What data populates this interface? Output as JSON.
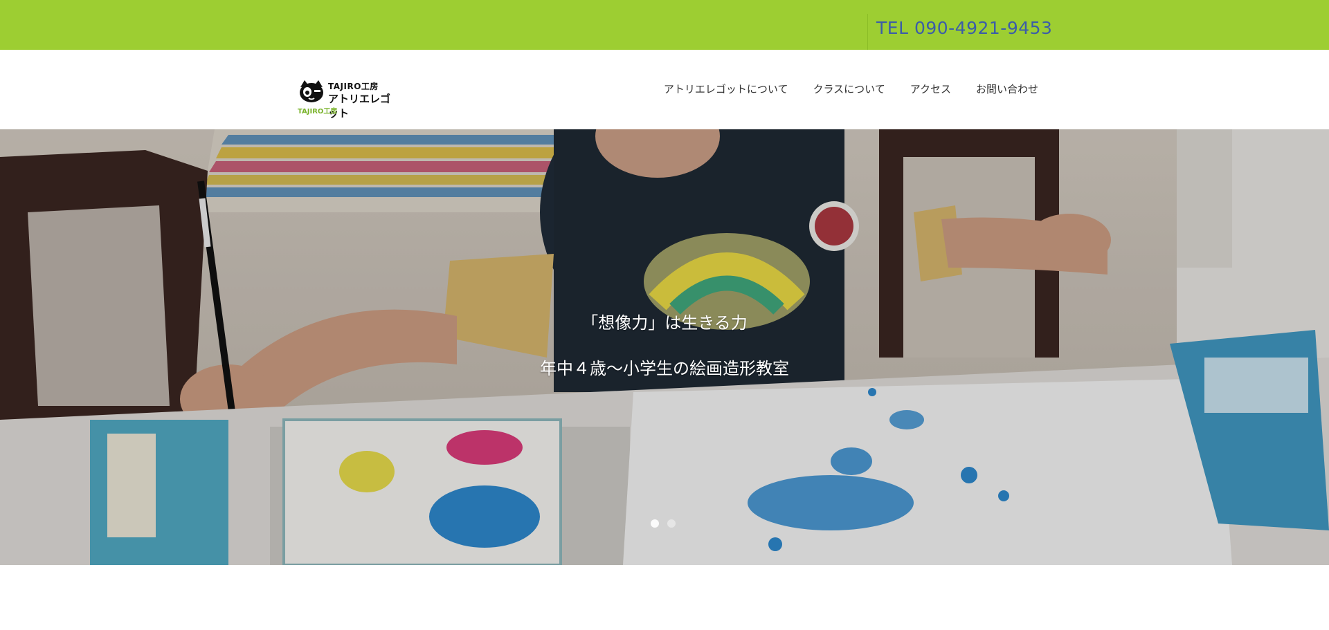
{
  "topbar": {
    "tel_text": "TEL 090-4921-9453",
    "color": "#9dce32",
    "tel_color": "#3b5da8"
  },
  "logo": {
    "line1": "TAJIRO工房",
    "line2": "アトリエレゴット",
    "line3": "TAJIRO工房",
    "icon": "cat-face-icon"
  },
  "nav": {
    "items": [
      {
        "label": "アトリエレゴットについて"
      },
      {
        "label": "クラスについて"
      },
      {
        "label": "アクセス"
      },
      {
        "label": "お問い合わせ"
      }
    ]
  },
  "hero": {
    "headline": "「想像力」は生きる力",
    "subheadline": "年中４歳〜小学生の絵画造形教室",
    "image": "child-painting-watercolor-photo",
    "slides": {
      "current": 1,
      "total": 2
    }
  }
}
